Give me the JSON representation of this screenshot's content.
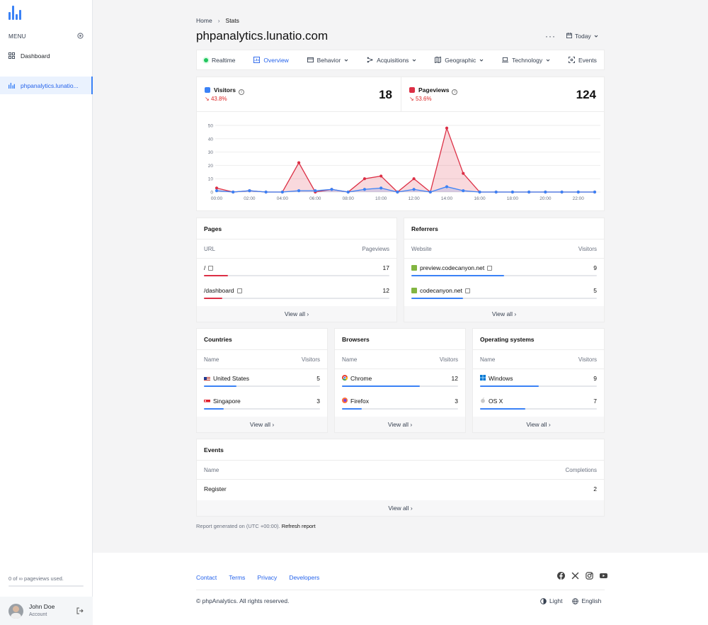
{
  "sidebar": {
    "menu_label": "MENU",
    "items": [
      {
        "label": "Dashboard",
        "icon": "grid-icon"
      },
      {
        "label": "phpanalytics.lunatio...",
        "icon": "bar-chart-icon"
      }
    ],
    "usage_text": "0 of ∞ pageviews used.",
    "user": {
      "name": "John Doe",
      "role": "Account"
    }
  },
  "header": {
    "breadcrumb": [
      "Home",
      "Stats"
    ],
    "title": "phpanalytics.lunatio.com",
    "date_label": "Today"
  },
  "tabs": [
    {
      "label": "Realtime"
    },
    {
      "label": "Overview"
    },
    {
      "label": "Behavior"
    },
    {
      "label": "Acquisitions"
    },
    {
      "label": "Geographic"
    },
    {
      "label": "Technology"
    },
    {
      "label": "Events"
    }
  ],
  "summary": {
    "visitors": {
      "label": "Visitors",
      "change": "43.8%",
      "value": "18",
      "color": "#3b82f6"
    },
    "pageviews": {
      "label": "Pageviews",
      "change": "53.6%",
      "value": "124",
      "color": "#dc2f45"
    }
  },
  "chart_data": {
    "type": "area",
    "x": [
      "00:00",
      "01:00",
      "02:00",
      "03:00",
      "04:00",
      "05:00",
      "06:00",
      "07:00",
      "08:00",
      "09:00",
      "10:00",
      "11:00",
      "12:00",
      "13:00",
      "14:00",
      "15:00",
      "16:00",
      "17:00",
      "18:00",
      "19:00",
      "20:00",
      "21:00",
      "22:00",
      "23:00"
    ],
    "x_tick_labels": [
      "00:00",
      "02:00",
      "04:00",
      "06:00",
      "08:00",
      "10:00",
      "12:00",
      "14:00",
      "16:00",
      "18:00",
      "20:00",
      "22:00"
    ],
    "y_ticks": [
      "0",
      "10",
      "20",
      "30",
      "40",
      "50"
    ],
    "ylim": [
      0,
      50
    ],
    "series": [
      {
        "name": "Pageviews",
        "color": "#dc2f45",
        "values": [
          3,
          0,
          1,
          0,
          0,
          22,
          0,
          2,
          0,
          10,
          12,
          0,
          10,
          0,
          48,
          14,
          0,
          0,
          0,
          0,
          0,
          0,
          0,
          0
        ]
      },
      {
        "name": "Visitors",
        "color": "#3b82f6",
        "values": [
          1,
          0,
          1,
          0,
          0,
          1,
          1,
          2,
          0,
          2,
          3,
          0,
          2,
          0,
          4,
          1,
          0,
          0,
          0,
          0,
          0,
          0,
          0,
          0
        ]
      }
    ]
  },
  "pages": {
    "title": "Pages",
    "col_left": "URL",
    "col_right": "Pageviews",
    "rows": [
      {
        "name": "/",
        "value": "17",
        "pct": 0.13
      },
      {
        "name": "/dashboard",
        "value": "12",
        "pct": 0.1
      }
    ],
    "view_all": "View all"
  },
  "referrers": {
    "title": "Referrers",
    "col_left": "Website",
    "col_right": "Visitors",
    "rows": [
      {
        "name": "preview.codecanyon.net",
        "value": "9",
        "pct": 0.5
      },
      {
        "name": "codecanyon.net",
        "value": "5",
        "pct": 0.28
      }
    ],
    "view_all": "View all"
  },
  "countries": {
    "title": "Countries",
    "col_left": "Name",
    "col_right": "Visitors",
    "rows": [
      {
        "name": "United States",
        "value": "5",
        "pct": 0.28
      },
      {
        "name": "Singapore",
        "value": "3",
        "pct": 0.17
      }
    ],
    "view_all": "View all"
  },
  "browsers": {
    "title": "Browsers",
    "col_left": "Name",
    "col_right": "Visitors",
    "rows": [
      {
        "name": "Chrome",
        "value": "12",
        "pct": 0.67
      },
      {
        "name": "Firefox",
        "value": "3",
        "pct": 0.17
      }
    ],
    "view_all": "View all"
  },
  "os": {
    "title": "Operating systems",
    "col_left": "Name",
    "col_right": "Visitors",
    "rows": [
      {
        "name": "Windows",
        "value": "9",
        "pct": 0.5
      },
      {
        "name": "OS X",
        "value": "7",
        "pct": 0.39
      }
    ],
    "view_all": "View all"
  },
  "events": {
    "title": "Events",
    "col_left": "Name",
    "col_right": "Completions",
    "rows": [
      {
        "name": "Register",
        "value": "2"
      }
    ],
    "view_all": "View all"
  },
  "report": {
    "text": "Report generated on (UTC +00:00).",
    "link": "Refresh report"
  },
  "footer": {
    "links": [
      "Contact",
      "Terms",
      "Privacy",
      "Developers"
    ],
    "copyright": "© phpAnalytics. All rights reserved.",
    "theme": "Light",
    "language": "English"
  },
  "colors": {
    "accent": "#3b82f6",
    "danger": "#dc2f45"
  }
}
